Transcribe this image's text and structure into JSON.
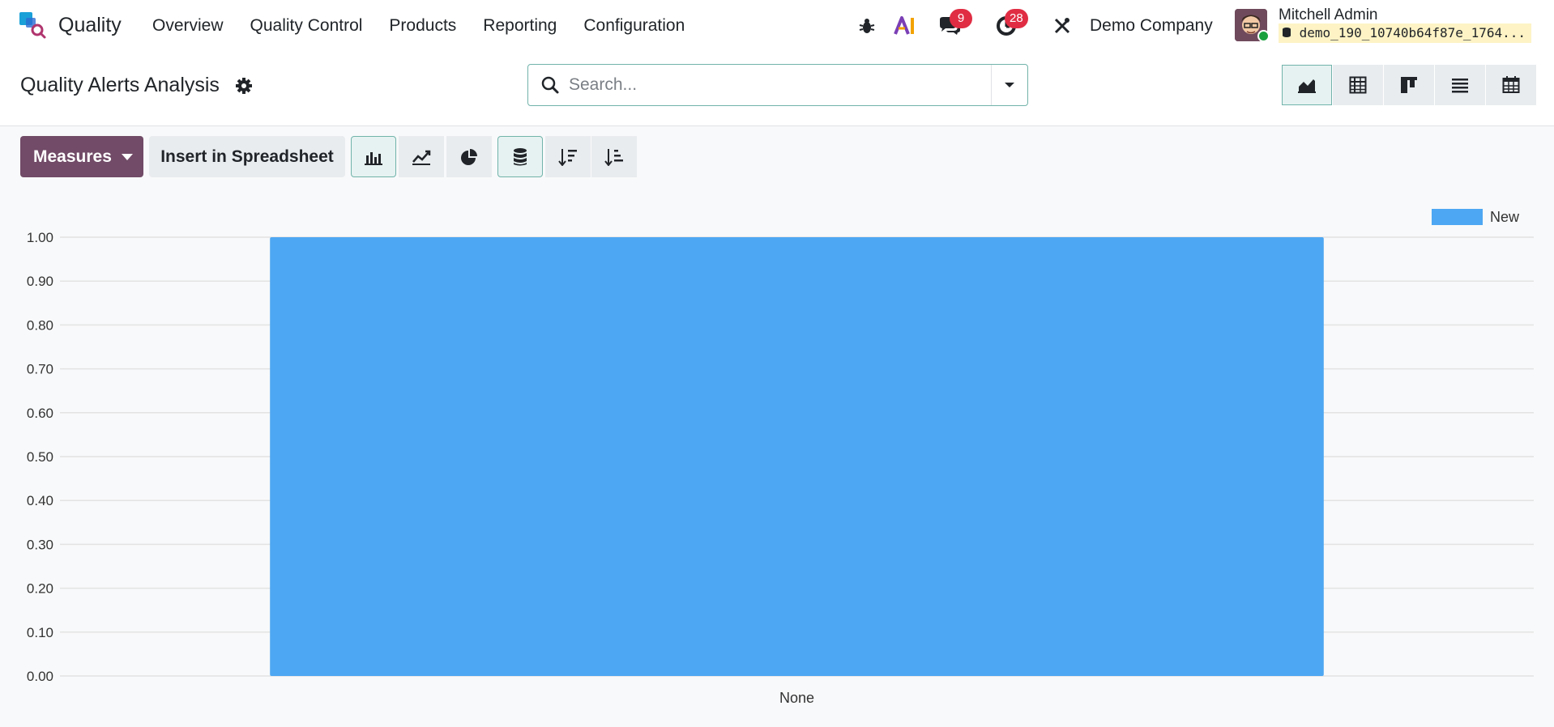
{
  "app": {
    "name": "Quality"
  },
  "menu": {
    "items": [
      "Overview",
      "Quality Control",
      "Products",
      "Reporting",
      "Configuration"
    ]
  },
  "systray": {
    "messages_count": "9",
    "activities_count": "28",
    "company": "Demo Company",
    "user_name": "Mitchell Admin",
    "database": "demo_190_10740b64f87e_1764..."
  },
  "control": {
    "title": "Quality Alerts Analysis",
    "search_placeholder": "Search..."
  },
  "toolbar": {
    "measures_label": "Measures",
    "insert_label": "Insert in Spreadsheet"
  },
  "colors": {
    "brand": "#714b67",
    "bar": "#4ea7f2",
    "badge": "#e02d43",
    "active_border": "#71b3aa"
  },
  "chart_data": {
    "type": "bar",
    "categories": [
      "None"
    ],
    "series": [
      {
        "name": "New",
        "values": [
          1.0
        ]
      }
    ],
    "ylim": [
      0,
      1.0
    ],
    "yticks": [
      "0.00",
      "0.10",
      "0.20",
      "0.30",
      "0.40",
      "0.50",
      "0.60",
      "0.70",
      "0.80",
      "0.90",
      "1.00"
    ],
    "legend_position": "top-right",
    "grid": true
  }
}
